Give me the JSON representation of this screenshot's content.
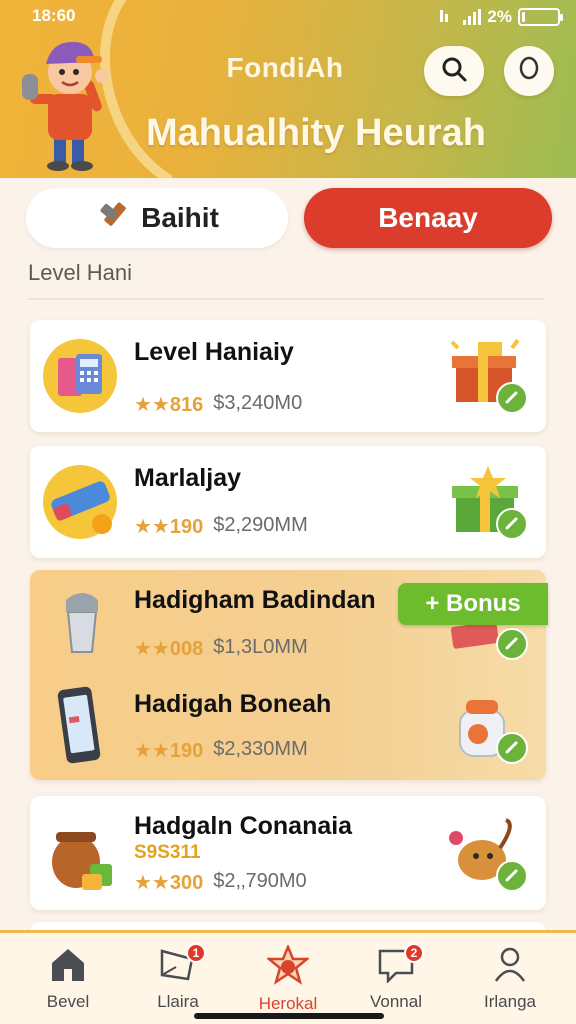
{
  "status": {
    "time": "18:60",
    "battery": "2%"
  },
  "header": {
    "app_name": "FondiAh",
    "hero_title": "Mahualhity Heurah"
  },
  "tabs": {
    "left_label": "Baihit",
    "right_label": "Benaay"
  },
  "section": {
    "label": "Level Hani"
  },
  "cards": [
    {
      "title": "Level Haniaiy",
      "stars": "★★816",
      "price": "$3,240M0"
    },
    {
      "title": "Marlaljay",
      "stars": "★★190",
      "price": "$2,290MM"
    },
    {
      "title": "Hadigham Badindan",
      "stars": "★★008",
      "price": "$1,3L0MM",
      "tag": "+ Bonus"
    },
    {
      "title": "Hadigah Boneah",
      "stars": "★★190",
      "price": "$2,330MM"
    },
    {
      "title": "Hadgaln Conanaia",
      "extra": "S9S311",
      "stars": "★★300",
      "price": "$2,‚790M0"
    }
  ],
  "nav": [
    {
      "label": "Bevel",
      "icon": "home-icon"
    },
    {
      "label": "Llaira",
      "icon": "chat-icon",
      "badge": "1"
    },
    {
      "label": "Herokal",
      "icon": "star-icon"
    },
    {
      "label": "Vonnal",
      "icon": "message-icon",
      "badge": "2"
    },
    {
      "label": "Irlanga",
      "icon": "profile-icon"
    }
  ],
  "colors": {
    "accent_red": "#db3c2c",
    "accent_green": "#6cbc2e",
    "header_orange": "#f2b43a"
  }
}
